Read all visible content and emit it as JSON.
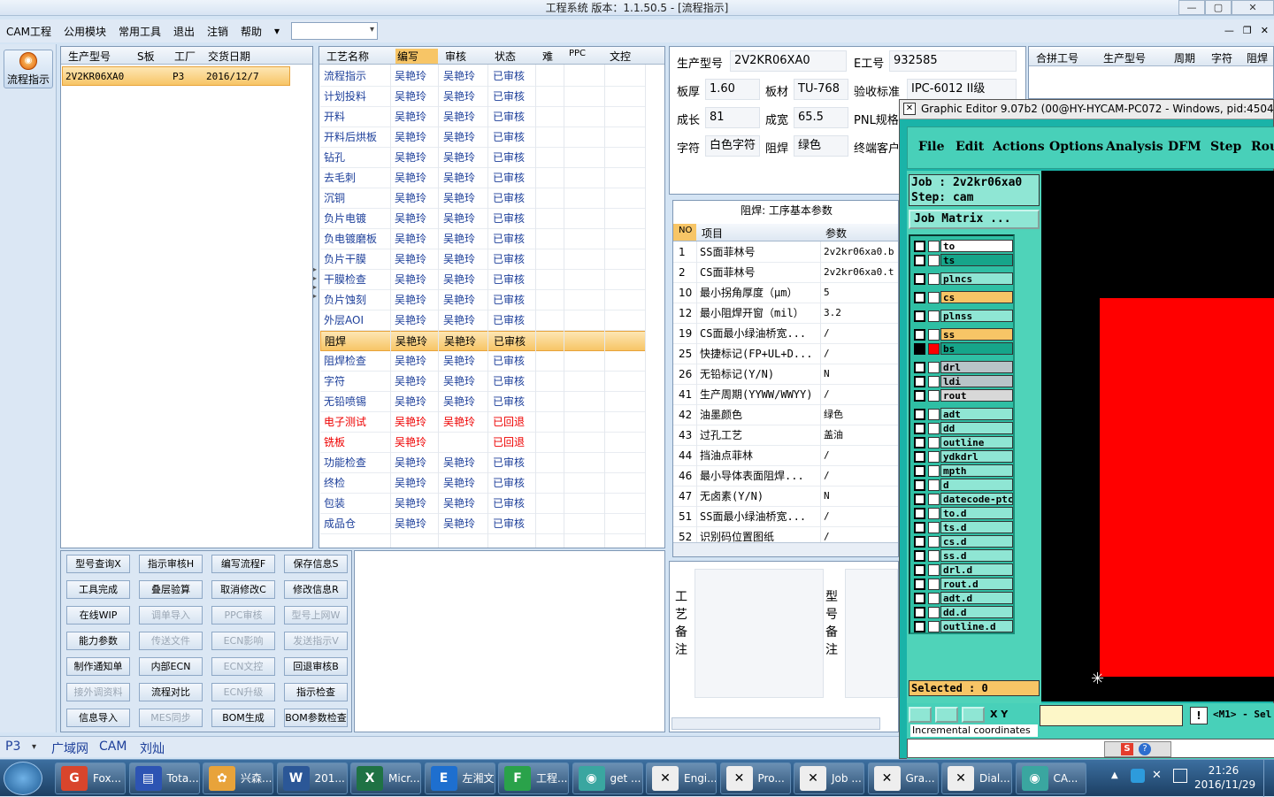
{
  "window": {
    "title": "工程系统   版本：1.1.50.5 - [流程指示]",
    "min": "—",
    "max": "▢",
    "close": "✕"
  },
  "menu": {
    "items": [
      "CAM工程",
      "公用模块",
      "常用工具",
      "退出",
      "注销",
      "帮助",
      "▾"
    ]
  },
  "mdi": {
    "min": "—",
    "restore": "❐",
    "close": "✕"
  },
  "leftbar": {
    "flow_label": "流程指示"
  },
  "orders": {
    "headers": [
      "生产型号",
      "S板",
      "工厂",
      "交货日期"
    ],
    "rows": [
      {
        "model": "2V2KR06XA0",
        "sboard": "",
        "factory": "P3",
        "date": "2016/12/7"
      }
    ]
  },
  "process": {
    "headers": [
      "工艺名称",
      "编写",
      "审核",
      "状态",
      "难",
      "PPC",
      "文控"
    ],
    "rows": [
      {
        "name": "流程指示",
        "writer": "吴艳玲",
        "reviewer": "吴艳玲",
        "status": "已审核",
        "state": "ok"
      },
      {
        "name": "计划投料",
        "writer": "吴艳玲",
        "reviewer": "吴艳玲",
        "status": "已审核",
        "state": "ok"
      },
      {
        "name": "开料",
        "writer": "吴艳玲",
        "reviewer": "吴艳玲",
        "status": "已审核",
        "state": "ok"
      },
      {
        "name": "开料后烘板",
        "writer": "吴艳玲",
        "reviewer": "吴艳玲",
        "status": "已审核",
        "state": "ok"
      },
      {
        "name": "钻孔",
        "writer": "吴艳玲",
        "reviewer": "吴艳玲",
        "status": "已审核",
        "state": "ok"
      },
      {
        "name": "去毛刺",
        "writer": "吴艳玲",
        "reviewer": "吴艳玲",
        "status": "已审核",
        "state": "ok"
      },
      {
        "name": "沉铜",
        "writer": "吴艳玲",
        "reviewer": "吴艳玲",
        "status": "已审核",
        "state": "ok"
      },
      {
        "name": "负片电镀",
        "writer": "吴艳玲",
        "reviewer": "吴艳玲",
        "status": "已审核",
        "state": "ok"
      },
      {
        "name": "负电镀磨板",
        "writer": "吴艳玲",
        "reviewer": "吴艳玲",
        "status": "已审核",
        "state": "ok"
      },
      {
        "name": "负片干膜",
        "writer": "吴艳玲",
        "reviewer": "吴艳玲",
        "status": "已审核",
        "state": "ok"
      },
      {
        "name": "干膜检查",
        "writer": "吴艳玲",
        "reviewer": "吴艳玲",
        "status": "已审核",
        "state": "ok"
      },
      {
        "name": "负片蚀刻",
        "writer": "吴艳玲",
        "reviewer": "吴艳玲",
        "status": "已审核",
        "state": "ok"
      },
      {
        "name": "外层AOI",
        "writer": "吴艳玲",
        "reviewer": "吴艳玲",
        "status": "已审核",
        "state": "ok"
      },
      {
        "name": "阻焊",
        "writer": "吴艳玲",
        "reviewer": "吴艳玲",
        "status": "已审核",
        "state": "selected"
      },
      {
        "name": "阻焊检查",
        "writer": "吴艳玲",
        "reviewer": "吴艳玲",
        "status": "已审核",
        "state": "ok"
      },
      {
        "name": "字符",
        "writer": "吴艳玲",
        "reviewer": "吴艳玲",
        "status": "已审核",
        "state": "ok"
      },
      {
        "name": "无铅喷锡",
        "writer": "吴艳玲",
        "reviewer": "吴艳玲",
        "status": "已审核",
        "state": "ok"
      },
      {
        "name": "电子测试",
        "writer": "吴艳玲",
        "reviewer": "吴艳玲",
        "status": "已回退",
        "state": "back"
      },
      {
        "name": "铣板",
        "writer": "吴艳玲",
        "reviewer": "",
        "status": "已回退",
        "state": "back"
      },
      {
        "name": "功能检查",
        "writer": "吴艳玲",
        "reviewer": "吴艳玲",
        "status": "已审核",
        "state": "ok"
      },
      {
        "name": "终检",
        "writer": "吴艳玲",
        "reviewer": "吴艳玲",
        "status": "已审核",
        "state": "ok"
      },
      {
        "name": "包装",
        "writer": "吴艳玲",
        "reviewer": "吴艳玲",
        "status": "已审核",
        "state": "ok"
      },
      {
        "name": "成品仓",
        "writer": "吴艳玲",
        "reviewer": "吴艳玲",
        "status": "已审核",
        "state": "ok"
      }
    ]
  },
  "buttons": [
    [
      {
        "label": "型号查询X",
        "enabled": true
      },
      {
        "label": "指示审核H",
        "enabled": true
      },
      {
        "label": "编写流程F",
        "enabled": true
      },
      {
        "label": "保存信息S",
        "enabled": true
      }
    ],
    [
      {
        "label": "工具完成",
        "enabled": true
      },
      {
        "label": "叠层验算",
        "enabled": true
      },
      {
        "label": "取消修改C",
        "enabled": true
      },
      {
        "label": "修改信息R",
        "enabled": true
      }
    ],
    [
      {
        "label": "在线WIP",
        "enabled": true
      },
      {
        "label": "调单导入",
        "enabled": false
      },
      {
        "label": "PPC审核",
        "enabled": false
      },
      {
        "label": "型号上网W",
        "enabled": false
      }
    ],
    [
      {
        "label": "能力参数",
        "enabled": true
      },
      {
        "label": "传送文件",
        "enabled": false
      },
      {
        "label": "ECN影响",
        "enabled": false
      },
      {
        "label": "发送指示V",
        "enabled": false
      }
    ],
    [
      {
        "label": "制作通知单",
        "enabled": true
      },
      {
        "label": "内部ECN",
        "enabled": true
      },
      {
        "label": "ECN文控",
        "enabled": false
      },
      {
        "label": "回退审核B",
        "enabled": true
      }
    ],
    [
      {
        "label": "接外调资料",
        "enabled": false
      },
      {
        "label": "流程对比",
        "enabled": true
      },
      {
        "label": "ECN升级",
        "enabled": false
      },
      {
        "label": "指示检查",
        "enabled": true
      }
    ],
    [
      {
        "label": "信息导入",
        "enabled": true
      },
      {
        "label": "MES同步",
        "enabled": false
      },
      {
        "label": "BOM生成",
        "enabled": true
      },
      {
        "label": "BOM参数检查",
        "enabled": true
      }
    ]
  ],
  "info": {
    "model_label": "生产型号",
    "model": "2V2KR06XA0",
    "eno_label": "E工号",
    "eno": "932585",
    "thick_label": "板厚",
    "thick": "1.60",
    "material_label": "板材",
    "material": "TU-768",
    "accept_label": "验收标准",
    "accept": "IPC-6012 II级",
    "len_label": "成长",
    "len": "81",
    "wid_label": "成宽",
    "wid": "65.5",
    "pnl_label": "PNL规格",
    "char_label": "字符",
    "char": "白色字符",
    "mask_label": "阻焊",
    "mask": "绿色",
    "cust_label": "终端客户"
  },
  "merge": {
    "headers": [
      "合拼工号",
      "生产型号",
      "周期",
      "字符",
      "阻焊"
    ]
  },
  "params": {
    "title": "阻焊: 工序基本参数",
    "headers": [
      "NO",
      "项目",
      "参数"
    ],
    "rows": [
      {
        "no": "1",
        "item": "SS面菲林号",
        "val": "2v2kr06xa0.b"
      },
      {
        "no": "2",
        "item": "CS面菲林号",
        "val": "2v2kr06xa0.t"
      },
      {
        "no": "10",
        "item": "最小拐角厚度（μm）",
        "val": "5"
      },
      {
        "no": "12",
        "item": "最小阻焊开窗（mil）",
        "val": "3.2"
      },
      {
        "no": "19",
        "item": "CS面最小绿油桥宽...",
        "val": "/"
      },
      {
        "no": "25",
        "item": "快捷标记(FP+UL+D...",
        "val": "/"
      },
      {
        "no": "26",
        "item": "无铅标记(Y/N)",
        "val": "N"
      },
      {
        "no": "41",
        "item": "生产周期(YYWW/WWYY)",
        "val": "/"
      },
      {
        "no": "42",
        "item": "油墨颜色",
        "val": "绿色"
      },
      {
        "no": "43",
        "item": "过孔工艺",
        "val": "盖油"
      },
      {
        "no": "44",
        "item": "挡油点菲林",
        "val": "/"
      },
      {
        "no": "46",
        "item": "最小导体表面阻焊...",
        "val": "/"
      },
      {
        "no": "47",
        "item": "无卤素(Y/N)",
        "val": "N"
      },
      {
        "no": "51",
        "item": "SS面最小绿油桥宽...",
        "val": "/"
      },
      {
        "no": "52",
        "item": "识别码位置图纸",
        "val": "/"
      }
    ]
  },
  "notes": {
    "process_label": "工艺备注",
    "model_label": "型号备注"
  },
  "status": {
    "factory": "P3",
    "net": "广域网",
    "dept": "CAM",
    "user": "刘灿"
  },
  "graphic_editor": {
    "title": "Graphic Editor 9.07b2 (00@HY-HYCAM-PC072 - Windows, pid:4504)",
    "menu": [
      "File",
      "Edit",
      "Actions",
      "Options",
      "Analysis",
      "DFM",
      "Step",
      "Rou"
    ],
    "job": "Job  : 2v2kr06xa0",
    "step": "Step: cam",
    "job_matrix": "Job Matrix ...",
    "layers": [
      {
        "name": "to",
        "color": "#ffffff"
      },
      {
        "name": "ts",
        "color": "#16a58a"
      },
      {
        "name": "plncs",
        "color": "#8fe6d4"
      },
      {
        "name": "cs",
        "color": "#f7c566"
      },
      {
        "name": "plnss",
        "color": "#8fe6d4"
      },
      {
        "name": "ss",
        "color": "#f7c566"
      },
      {
        "name": "bs",
        "color": "#16a58a"
      },
      {
        "name": "drl",
        "color": "#b8c4c8"
      },
      {
        "name": "ldi",
        "color": "#b8c4c8"
      },
      {
        "name": "rout",
        "color": "#d8d8d8"
      },
      {
        "name": "adt",
        "color": "#8fe6d4"
      },
      {
        "name": "dd",
        "color": "#8fe6d4"
      },
      {
        "name": "outline",
        "color": "#8fe6d4"
      },
      {
        "name": "ydkdrl",
        "color": "#8fe6d4"
      },
      {
        "name": "mpth",
        "color": "#8fe6d4"
      },
      {
        "name": "d",
        "color": "#8fe6d4"
      },
      {
        "name": "datecode-ptc",
        "color": "#8fe6d4"
      },
      {
        "name": "to.d",
        "color": "#8fe6d4"
      },
      {
        "name": "ts.d",
        "color": "#8fe6d4"
      },
      {
        "name": "cs.d",
        "color": "#8fe6d4"
      },
      {
        "name": "ss.d",
        "color": "#8fe6d4"
      },
      {
        "name": "drl.d",
        "color": "#8fe6d4"
      },
      {
        "name": "rout.d",
        "color": "#8fe6d4"
      },
      {
        "name": "adt.d",
        "color": "#8fe6d4"
      },
      {
        "name": "dd.d",
        "color": "#8fe6d4"
      },
      {
        "name": "outline.d",
        "color": "#8fe6d4"
      }
    ],
    "selected": "Selected : 0",
    "incremental": "Incremental coordinates",
    "mode": "<M1> - Sel",
    "xy": "X Y"
  },
  "taskbar": {
    "items": [
      {
        "label": "Fox...",
        "icon": "G",
        "color": "#d9452c"
      },
      {
        "label": "Tota...",
        "icon": "▤",
        "color": "#2d54b3"
      },
      {
        "label": "兴森...",
        "icon": "✿",
        "color": "#e8a33a"
      },
      {
        "label": "201...",
        "icon": "W",
        "color": "#2b5797"
      },
      {
        "label": "Micr...",
        "icon": "X",
        "color": "#1f7244"
      },
      {
        "label": "左湘文",
        "icon": "E",
        "color": "#1e6fcf"
      },
      {
        "label": "工程...",
        "icon": "F",
        "color": "#2aa24a"
      },
      {
        "label": "get ...",
        "icon": "◉",
        "color": "#3aa6a0"
      },
      {
        "label": "Engi...",
        "icon": "✕",
        "color": "#eeeeee"
      },
      {
        "label": "Pro...",
        "icon": "✕",
        "color": "#eeeeee"
      },
      {
        "label": "Job ...",
        "icon": "✕",
        "color": "#eeeeee"
      },
      {
        "label": "Gra...",
        "icon": "✕",
        "color": "#eeeeee"
      },
      {
        "label": "Dial...",
        "icon": "✕",
        "color": "#eeeeee"
      },
      {
        "label": "CA...",
        "icon": "◉",
        "color": "#3aa6a0"
      }
    ],
    "time": "21:26",
    "date": "2016/11/29"
  }
}
